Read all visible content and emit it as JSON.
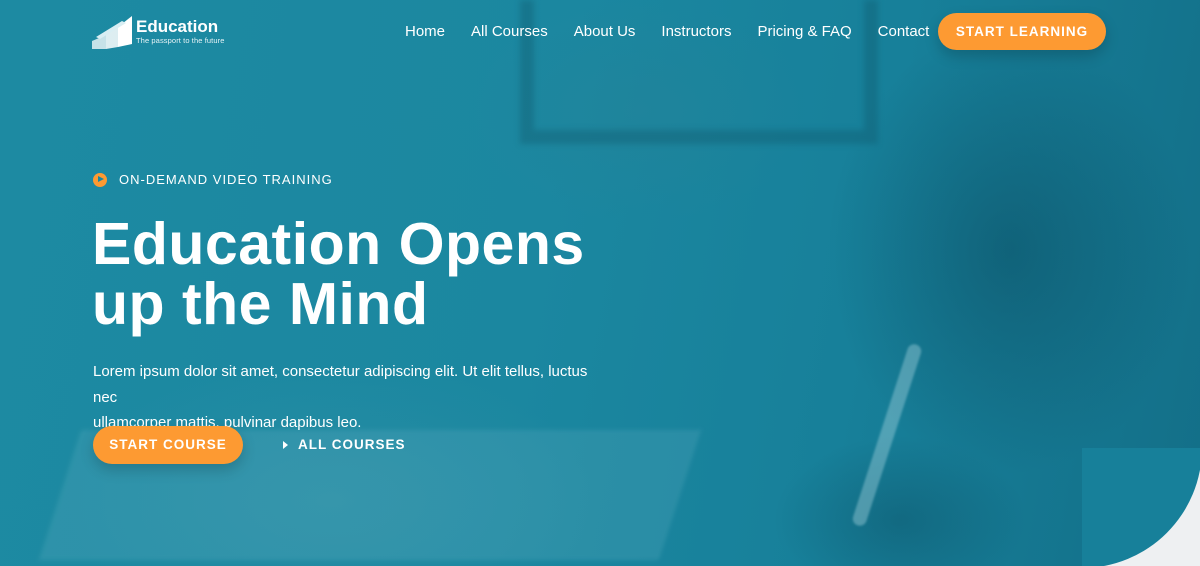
{
  "brand": {
    "name": "Education",
    "tagline": "The passport to the future"
  },
  "nav": {
    "items": [
      {
        "label": "Home"
      },
      {
        "label": "All Courses"
      },
      {
        "label": "About Us"
      },
      {
        "label": "Instructors"
      },
      {
        "label": "Pricing & FAQ"
      },
      {
        "label": "Contact"
      }
    ],
    "cta_label": "START LEARNING"
  },
  "hero": {
    "eyebrow": "ON-DEMAND VIDEO TRAINING",
    "headline_line1": "Education Opens",
    "headline_line2": "up the Mind",
    "description_line1": "Lorem ipsum dolor sit amet, consectetur adipiscing elit. Ut elit tellus, luctus nec",
    "description_line2": "ullamcorper mattis, pulvinar dapibus leo.",
    "primary_button": "START COURSE",
    "secondary_link": "ALL COURSES"
  },
  "colors": {
    "hero_teal": "#1b87a0",
    "accent_orange": "#fd9a32",
    "text_white": "#ffffff",
    "page_background": "#eef0f2"
  },
  "icons": {
    "logo": "staircase-logo-icon",
    "eyebrow": "play-circle-icon",
    "link": "caret-right-icon"
  }
}
